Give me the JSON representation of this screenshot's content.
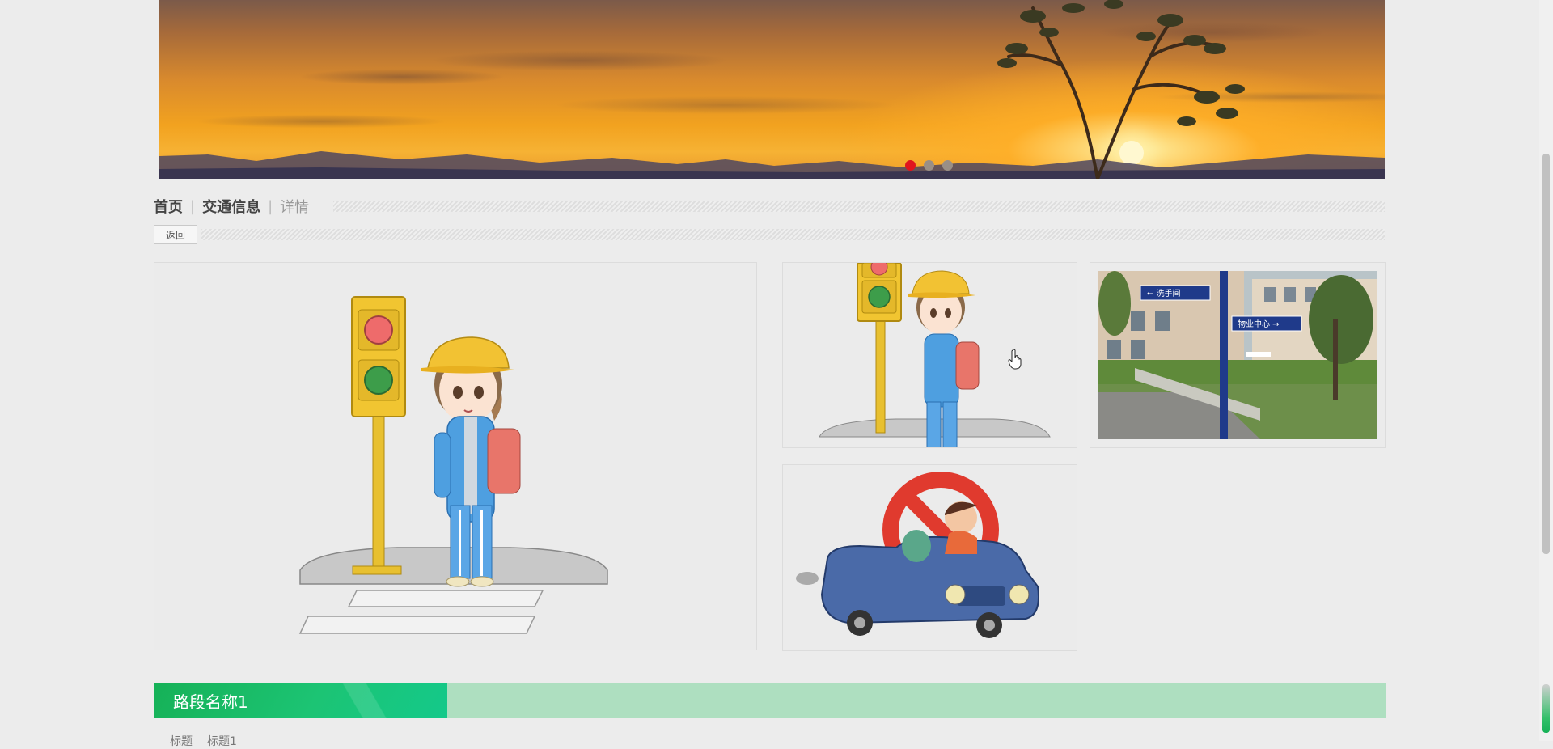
{
  "banner": {
    "slides": 3,
    "active_slide": 1,
    "colors": {
      "active_dot": "#e0141e",
      "dot": "#9a8f86"
    }
  },
  "breadcrumb": {
    "items": [
      "首页",
      "交通信息",
      "详情"
    ]
  },
  "back_button": {
    "label": "返回"
  },
  "gallery": {
    "images": [
      {
        "icon": "girl-traffic-light-illustration"
      },
      {
        "icon": "girl-traffic-light-illustration"
      },
      {
        "icon": "street-sign-photo"
      },
      {
        "icon": "no-entry-car-illustration"
      }
    ]
  },
  "section": {
    "title": "路段名称1",
    "colors": {
      "accent": "#16b157",
      "bar": "#aedfc0"
    }
  },
  "below": {
    "label": "标题",
    "value": "标题1"
  }
}
